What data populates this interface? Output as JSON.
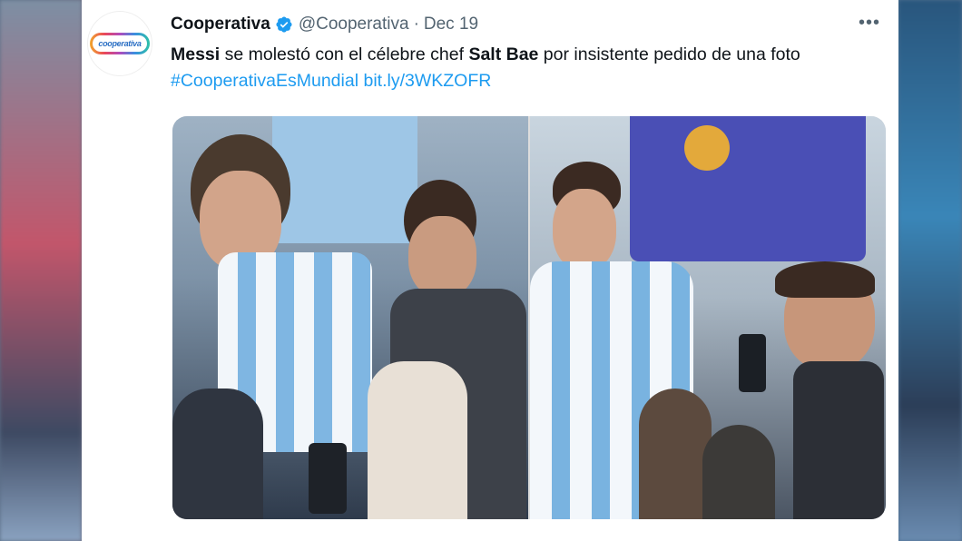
{
  "tweet": {
    "author_name": "Cooperativa",
    "logo_text": "cooperativa",
    "handle": "@Cooperativa",
    "separator": "·",
    "date": "Dec 19",
    "more": "•••",
    "text": {
      "part1": "Messi",
      "part2": " se molestó con el célebre chef ",
      "part3": "Salt Bae",
      "part4": " por insistente pedido de una foto ",
      "hashtag": "#CooperativaEsMundial",
      "space": " ",
      "url": "bit.ly/3WKZOFR"
    }
  },
  "colors": {
    "link": "#1d9bf0",
    "verified": "#1d9bf0",
    "text": "#0f1419",
    "muted": "#536471"
  }
}
